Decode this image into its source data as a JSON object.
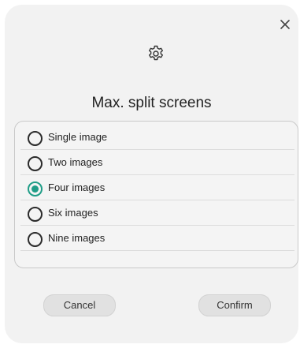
{
  "dialog": {
    "title": "Max. split screens",
    "icons": {
      "top": "gear-icon",
      "close": "close-icon"
    },
    "options": [
      {
        "label": "Single image",
        "selected": false
      },
      {
        "label": "Two images",
        "selected": false
      },
      {
        "label": "Four images",
        "selected": true
      },
      {
        "label": "Six images",
        "selected": false
      },
      {
        "label": "Nine images",
        "selected": false
      }
    ],
    "cancel_label": "Cancel",
    "confirm_label": "Confirm"
  },
  "colors": {
    "accent": "#1f9d87",
    "dialog_background": "#f2f2f2",
    "button_background": "#e1e1e1"
  }
}
